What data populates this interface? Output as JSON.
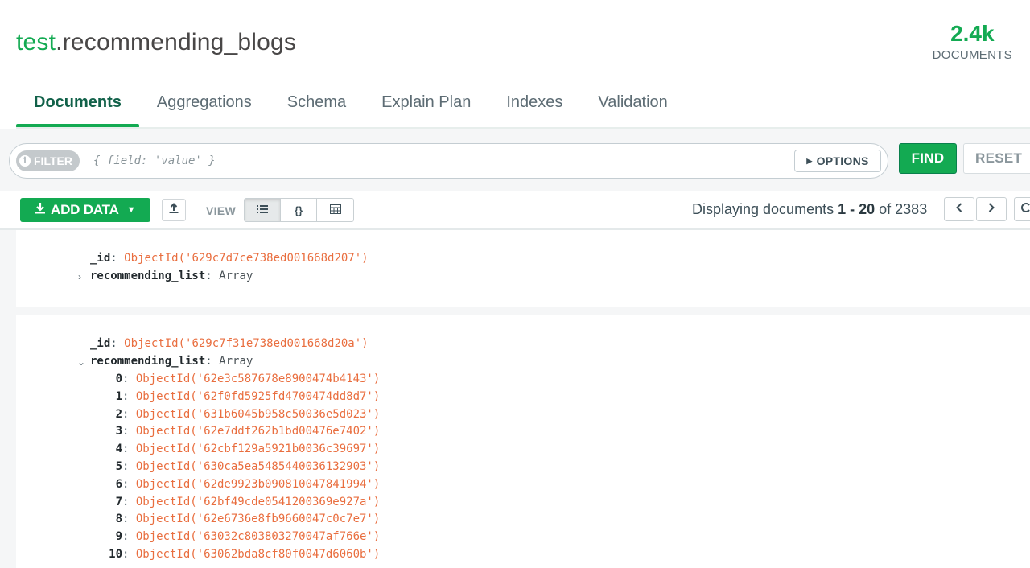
{
  "namespace": {
    "db": "test",
    "collection": ".recommending_blogs"
  },
  "doc_count": {
    "value": "2.4k",
    "label": "DOCUMENTS"
  },
  "tabs": [
    "Documents",
    "Aggregations",
    "Schema",
    "Explain Plan",
    "Indexes",
    "Validation"
  ],
  "query": {
    "filter_label": "FILTER",
    "filter_placeholder": "{ field: 'value' }",
    "options_label": "OPTIONS",
    "find_label": "FIND",
    "reset_label": "RESET"
  },
  "toolbar": {
    "add_data_label": "ADD DATA",
    "view_label": "VIEW",
    "view_modes": [
      "list",
      "json",
      "table"
    ],
    "paging": {
      "prefix": "Displaying documents ",
      "start": "1",
      "sep": " - ",
      "end": "20",
      "of": " of ",
      "total": "2383"
    }
  },
  "documents": [
    {
      "id_key": "_id",
      "id_value": "ObjectId('629c7d7ce738ed001668d207')",
      "list_key": "recommending_list",
      "list_type": "Array",
      "expanded": false,
      "items": []
    },
    {
      "id_key": "_id",
      "id_value": "ObjectId('629c7f31e738ed001668d20a')",
      "list_key": "recommending_list",
      "list_type": "Array",
      "expanded": true,
      "items": [
        "ObjectId('62e3c587678e8900474b4143')",
        "ObjectId('62f0fd5925fd4700474dd8d7')",
        "ObjectId('631b6045b958c50036e5d023')",
        "ObjectId('62e7ddf262b1bd00476e7402')",
        "ObjectId('62cbf129a5921b0036c39697')",
        "ObjectId('630ca5ea5485440036132903')",
        "ObjectId('62de9923b090810047841994')",
        "ObjectId('62bf49cde0541200369e927a')",
        "ObjectId('62e6736e8fb9660047c0c7e7')",
        "ObjectId('63032c803803270047af766e')",
        "ObjectId('63062bda8cf80f0047d6060b')"
      ]
    }
  ]
}
